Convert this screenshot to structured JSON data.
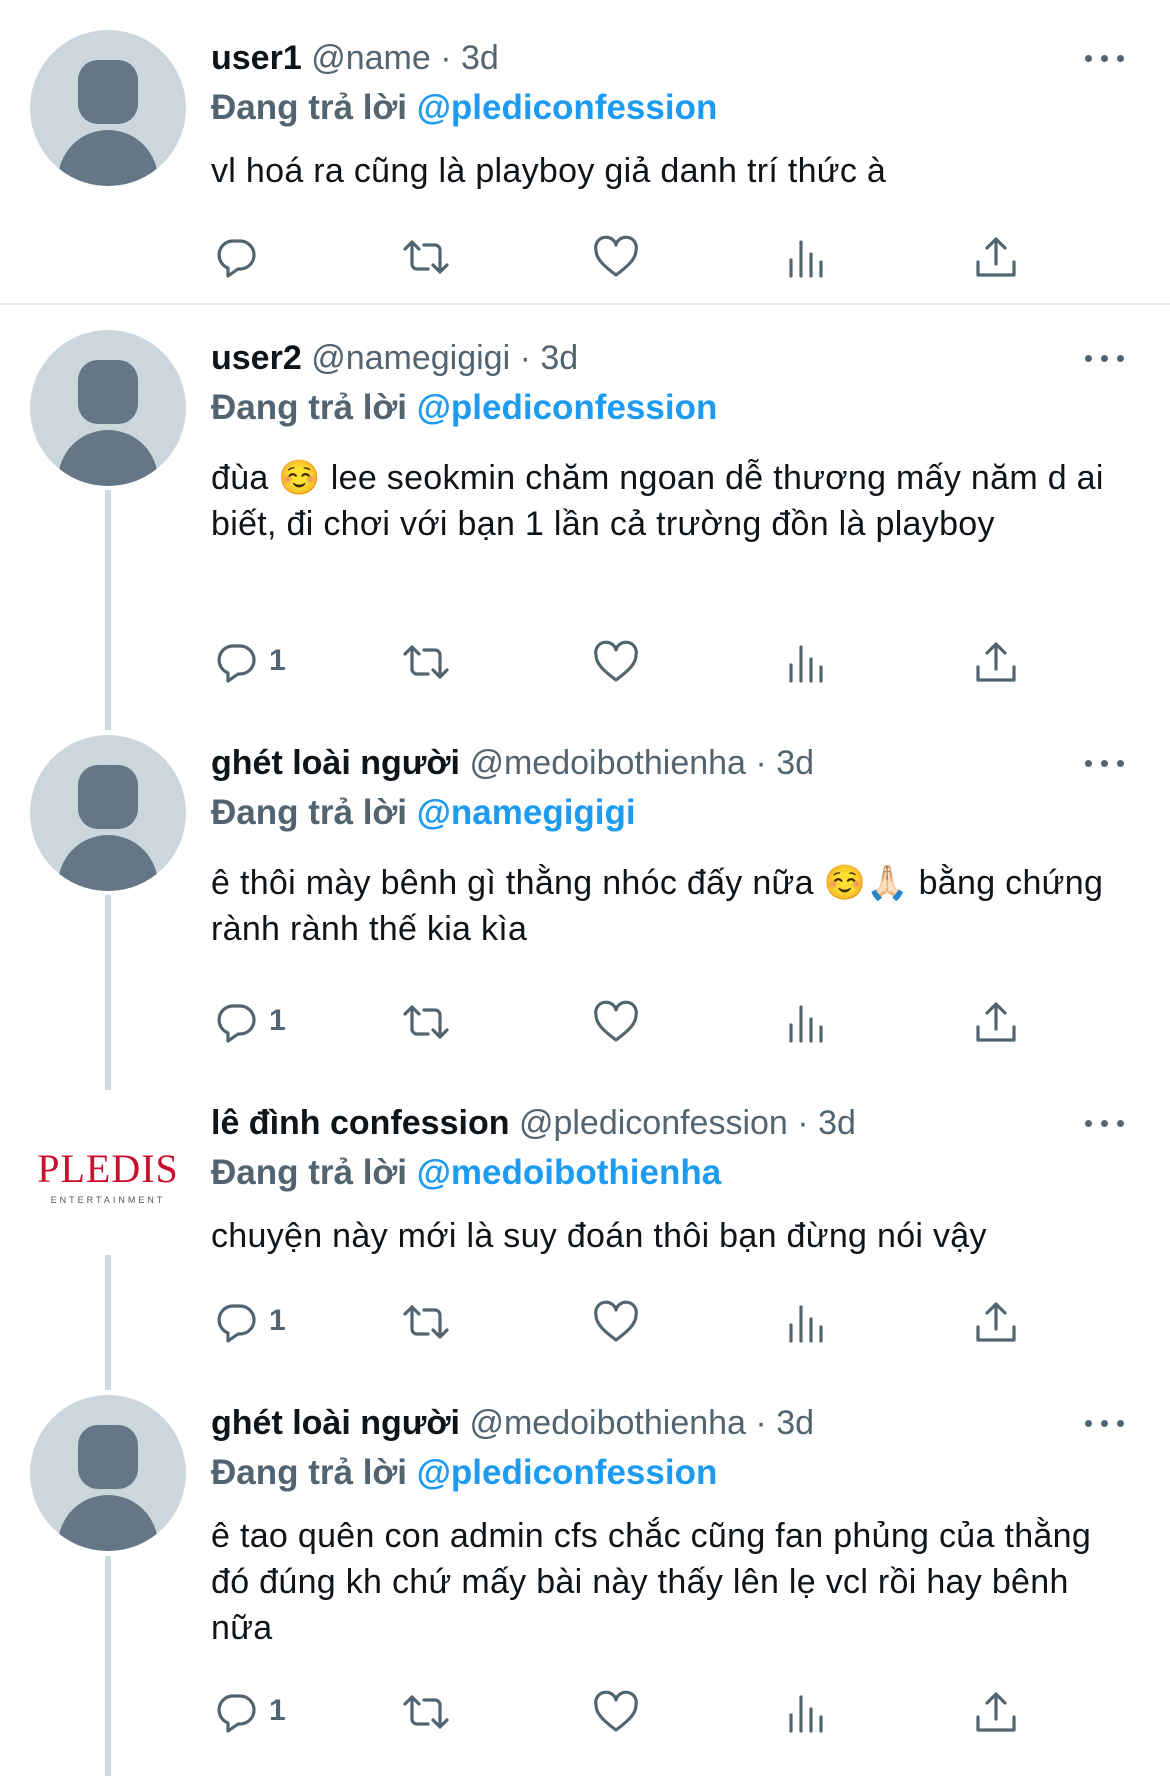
{
  "tweets": [
    {
      "avatar": "default-avatar",
      "name": "user1",
      "handle": "@name",
      "dot": "·",
      "time": "3d",
      "reply_prefix": "Đang trả lời",
      "reply_to": "@plediconfession",
      "text": "vl hoá ra cũng là playboy giả danh trí thức à",
      "reply_count": ""
    },
    {
      "avatar": "default-avatar",
      "name": "user2",
      "handle": "@namegigigi",
      "dot": "·",
      "time": "3d",
      "reply_prefix": "Đang trả lời",
      "reply_to": "@plediconfession",
      "text": "đùa ☺️  lee seokmin chăm ngoan dễ thương mấy năm d ai biết, đi chơi với bạn 1 lần cả trường đồn là playboy",
      "reply_count": "1"
    },
    {
      "avatar": "default-avatar",
      "name": "ghét loài người",
      "handle": "@medoibothienha",
      "dot": "·",
      "time": "3d",
      "reply_prefix": "Đang trả lời",
      "reply_to": "@namegigigi",
      "text": "ê thôi mày bênh gì thằng nhóc đấy nữa ☺️🙏🏻 bằng chứng rành rành thế kia kìa",
      "reply_count": "1"
    },
    {
      "avatar": "pledis-logo",
      "logo_main": "PLEDIS",
      "logo_sub": "ENTERTAINMENT",
      "name": "lê đình confession",
      "handle": "@plediconfession",
      "dot": "·",
      "time": "3d",
      "reply_prefix": "Đang trả lời",
      "reply_to": "@medoibothienha",
      "text": "chuyện này mới là suy đoán thôi bạn đừng nói vậy",
      "reply_count": "1"
    },
    {
      "avatar": "default-avatar",
      "name": "ghét loài người",
      "handle": "@medoibothienha",
      "dot": "·",
      "time": "3d",
      "reply_prefix": "Đang trả lời",
      "reply_to": "@plediconfession",
      "text": "ê tao quên con admin cfs chắc cũng fan phủng của thằng đó đúng kh chứ mấy bài này thấy lên lẹ vcl rồi hay bênh nữa",
      "reply_count": "1"
    }
  ],
  "icons": {
    "reply": "reply-icon",
    "retweet": "retweet-icon",
    "like": "heart-icon",
    "views": "views-icon",
    "share": "share-icon",
    "more": "more-icon"
  },
  "colors": {
    "accent": "#1d9bf0",
    "secondary_text": "#536471",
    "primary_text": "#0f1419",
    "avatar_bg": "#ccd6dd",
    "avatar_fg": "#657786",
    "logo_red": "#c8102e"
  }
}
